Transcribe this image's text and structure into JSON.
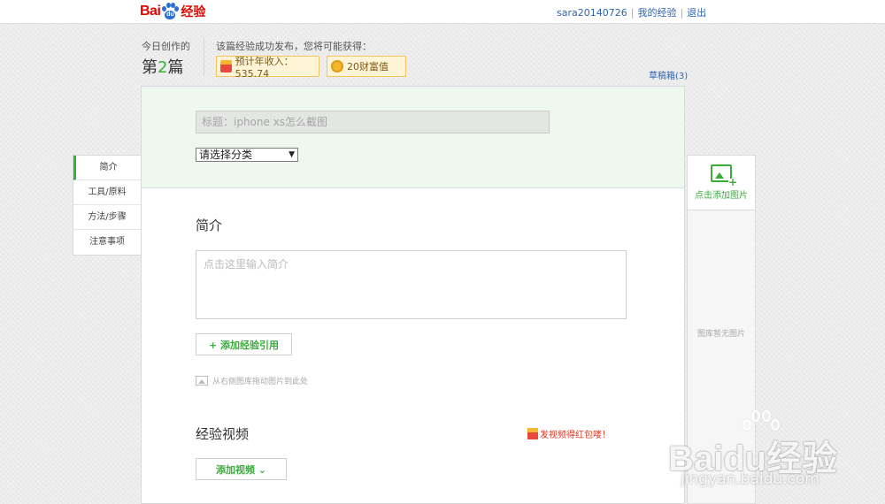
{
  "topbar": {
    "logo": {
      "bai": "Bai",
      "du": "du",
      "suffix": "经验"
    },
    "username": "sara20140726",
    "my_experience": "我的经验",
    "logout": "退出"
  },
  "header": {
    "today_label": "今日创作的",
    "today_prefix": "第",
    "today_num": "2",
    "today_suffix": "篇",
    "publish_hint": "该篇经验成功发布，您将可能获得：",
    "income_label": "预计年收入：535.74",
    "wealth_label": "20财富值",
    "drafts_label": "草稿箱(3)"
  },
  "form": {
    "title_placeholder": "标题：iphone xs怎么截图",
    "category_value": "请选择分类",
    "intro_heading": "简介",
    "intro_placeholder": "点击这里输入简介",
    "add_reference": "+ 添加经验引用",
    "drag_hint": "从右侧图库拖动图片到此处",
    "video_heading": "经验视频",
    "video_promo": "发视频得红包喽！",
    "add_video": "添加视频 ⌄"
  },
  "left_nav": {
    "items": [
      {
        "label": "简介"
      },
      {
        "label": "工具/原料"
      },
      {
        "label": "方法/步骤"
      },
      {
        "label": "注意事项"
      }
    ]
  },
  "right_panel": {
    "add_image": "点击添加图片",
    "empty_gallery": "图库暂无图片"
  },
  "watermark": {
    "brand": "Baidu经验",
    "url": "jingyan.baidu.com"
  },
  "colors": {
    "accent_green": "#3cab3c",
    "brand_red": "#e10602",
    "link_blue": "#2d64b3",
    "promo_red": "#e0341f"
  }
}
